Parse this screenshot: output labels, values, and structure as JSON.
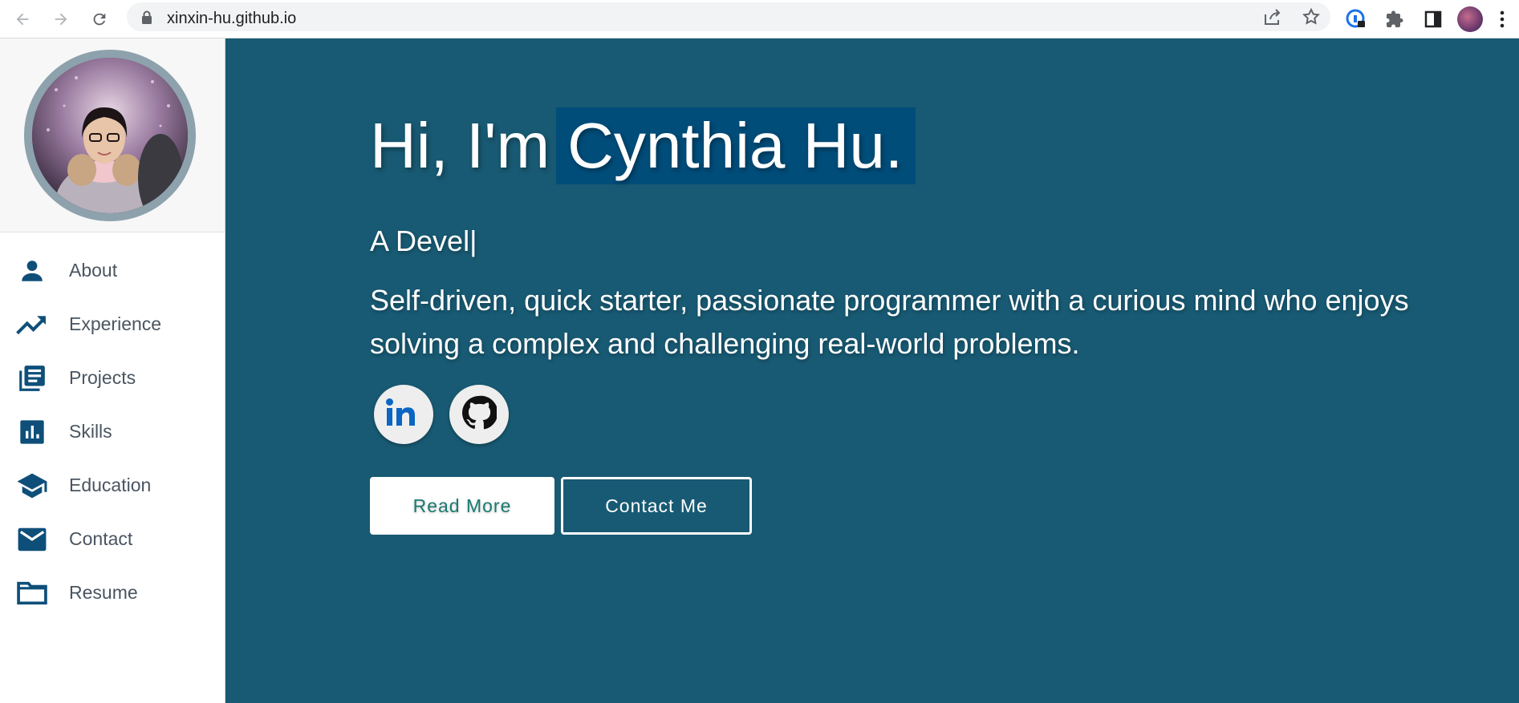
{
  "browser": {
    "url": "xinxin-hu.github.io",
    "icons": [
      "back-icon",
      "forward-icon",
      "reload-icon",
      "lock-icon",
      "share-icon",
      "star-icon",
      "password-manager-icon",
      "extensions-icon",
      "side-panel-icon",
      "profile-avatar",
      "more-icon"
    ]
  },
  "sidebar": {
    "items": [
      {
        "label": "About",
        "icon": "person-icon"
      },
      {
        "label": "Experience",
        "icon": "trending-up-icon"
      },
      {
        "label": "Projects",
        "icon": "library-books-icon"
      },
      {
        "label": "Skills",
        "icon": "bar-chart-icon"
      },
      {
        "label": "Education",
        "icon": "graduation-cap-icon"
      },
      {
        "label": "Contact",
        "icon": "mail-icon"
      },
      {
        "label": "Resume",
        "icon": "folder-icon"
      }
    ]
  },
  "hero": {
    "greeting": "Hi, I'm",
    "name": "Cynthia Hu.",
    "role": "A Devel|",
    "description": "Self-driven, quick starter, passionate programmer with a curious mind who enjoys solving a complex and challenging real-world problems.",
    "read_more": "Read More",
    "contact_me": "Contact Me"
  },
  "colors": {
    "hero_bg": "#185a73",
    "name_highlight": "#004d7a",
    "nav_icon": "#0e4f7a",
    "read_more_text": "#1a7a70"
  }
}
